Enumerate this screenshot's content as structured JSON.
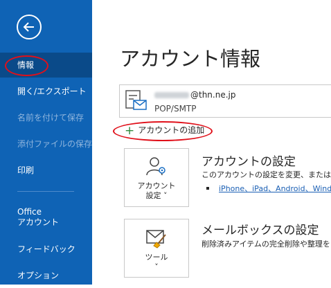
{
  "sidebar": {
    "items": [
      {
        "label": "情報"
      },
      {
        "label": "開く/エクスポート"
      },
      {
        "label": "名前を付けて保存"
      },
      {
        "label": "添付ファイルの保存"
      },
      {
        "label": "印刷"
      },
      {
        "label_line1": "Office",
        "label_line2": "アカウント"
      },
      {
        "label": "フィードバック"
      },
      {
        "label": "オプション"
      }
    ]
  },
  "main": {
    "title": "アカウント情報",
    "account": {
      "email_domain": "@thn.ne.jp",
      "type": "POP/SMTP"
    },
    "add_account_label": "アカウントの追加",
    "account_settings": {
      "tile_line1": "アカウント",
      "tile_line2": "設定 ˅",
      "heading": "アカウントの設定",
      "description": "このアカウントの設定を変更、または追加",
      "bullet": "iPhone、iPad、Android、Windo"
    },
    "mailbox_settings": {
      "tile_line1": "ツール",
      "tile_line2": "˅",
      "heading": "メールボックスの設定",
      "description": "削除済みアイテムの完全削除や整理を"
    }
  },
  "colors": {
    "sidebar_bg": "#0f63b5",
    "sidebar_active": "#0a4a89",
    "highlight_circle": "#e0101a",
    "link": "#1a5fb4"
  }
}
